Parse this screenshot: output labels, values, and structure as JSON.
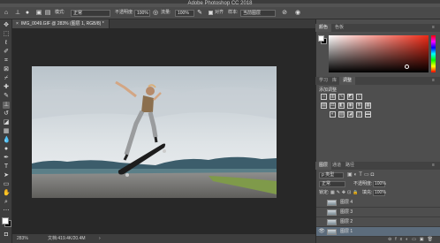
{
  "app": {
    "title": "Adobe Photoshop CC 2018"
  },
  "options": {
    "mode_label": "模式:",
    "mode_value": "正常",
    "opacity_label": "不透明度:",
    "opacity_value": "100%",
    "flow_label": "流量:",
    "flow_value": "100%",
    "align_label": "对齐",
    "sample_label": "样本:",
    "sample_value": "当前图层"
  },
  "document": {
    "tab_title": "IMG_0049.GIF @ 283% (图层 1, RGB/8) *",
    "close_glyph": "×"
  },
  "status": {
    "zoom": "283%",
    "doc_info": "文档:419.4K/20.4M"
  },
  "panels": {
    "color_tabs": [
      "颜色",
      "色板"
    ],
    "mid_tabs": [
      "学习",
      "库",
      "调整"
    ],
    "add_adjustment": "添加调整",
    "layer_tabs": [
      "图层",
      "通道",
      "路径"
    ],
    "kind_label": "ρ 类型",
    "blend_mode": "正常",
    "opacity_label": "不透明度:",
    "opacity_value": "100%",
    "lock_label": "锁定:",
    "fill_label": "填充:",
    "fill_value": "100%",
    "layers": [
      {
        "name": "图层 4",
        "visible": false,
        "selected": false
      },
      {
        "name": "图层 3",
        "visible": false,
        "selected": false
      },
      {
        "name": "图层 2",
        "visible": false,
        "selected": false
      },
      {
        "name": "图层 1",
        "visible": true,
        "selected": true
      }
    ]
  },
  "colors": {
    "foreground": "#ffffff",
    "background": "#000000",
    "accent": "#ef2a16",
    "selection": "#5c6c7c"
  },
  "icons": {
    "tools": [
      "move-icon",
      "marquee-icon",
      "lasso-icon",
      "quick-select-icon",
      "crop-icon",
      "eyedropper-icon",
      "healing-icon",
      "brush-icon",
      "clone-stamp-icon",
      "history-brush-icon",
      "eraser-icon",
      "gradient-icon",
      "blur-icon",
      "dodge-icon",
      "pen-icon",
      "type-icon",
      "path-select-icon",
      "rectangle-icon",
      "hand-icon",
      "zoom-icon",
      "more-icon"
    ]
  }
}
